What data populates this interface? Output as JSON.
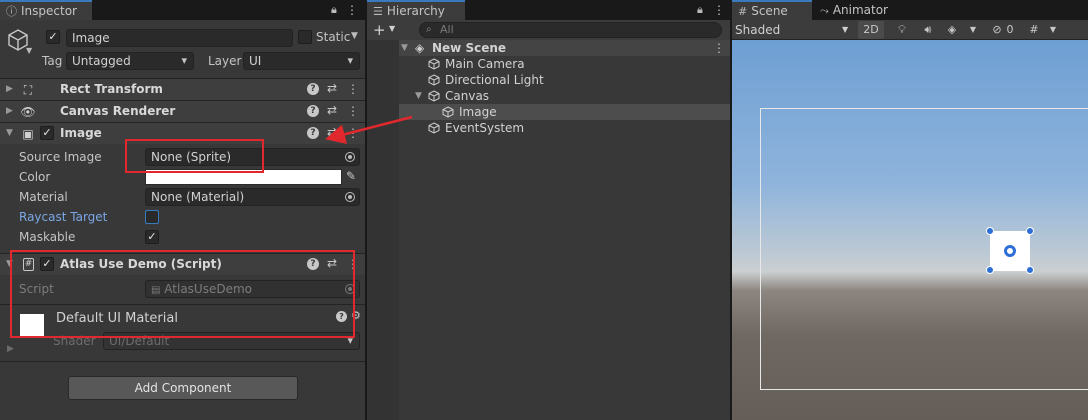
{
  "inspector": {
    "tab_label": "Inspector",
    "object_name": "Image",
    "static_label": "Static",
    "tag_label": "Tag",
    "tag_value": "Untagged",
    "layer_label": "Layer",
    "layer_value": "UI",
    "components": {
      "rect_transform": "Rect Transform",
      "canvas_renderer": "Canvas Renderer",
      "image": "Image",
      "atlas_script": "Atlas Use Demo (Script)"
    },
    "image_fields": {
      "source_image_label": "Source Image",
      "source_image_value": "None (Sprite)",
      "color_label": "Color",
      "material_label": "Material",
      "material_value": "None (Material)",
      "raycast_label": "Raycast Target",
      "maskable_label": "Maskable"
    },
    "script_fields": {
      "script_label": "Script",
      "script_value": "AtlasUseDemo"
    },
    "material_preview": {
      "name": "Default UI Material",
      "shader_label": "Shader",
      "shader_value": "UI/Default"
    },
    "add_component_label": "Add Component"
  },
  "hierarchy": {
    "tab_label": "Hierarchy",
    "search_placeholder": "All",
    "scene_name": "New Scene",
    "items": [
      {
        "label": "Main Camera"
      },
      {
        "label": "Directional Light"
      },
      {
        "label": "Canvas"
      },
      {
        "label": "Image"
      },
      {
        "label": "EventSystem"
      }
    ]
  },
  "scene": {
    "tab_label": "Scene",
    "animator_tab_label": "Animator",
    "shading_mode": "Shaded",
    "mode_2d": "2D",
    "hidden_count": "0"
  },
  "colors": {
    "annotation_red": "#e0282d",
    "accent_blue": "#3a79bb",
    "selection": "#4d4d4d"
  }
}
